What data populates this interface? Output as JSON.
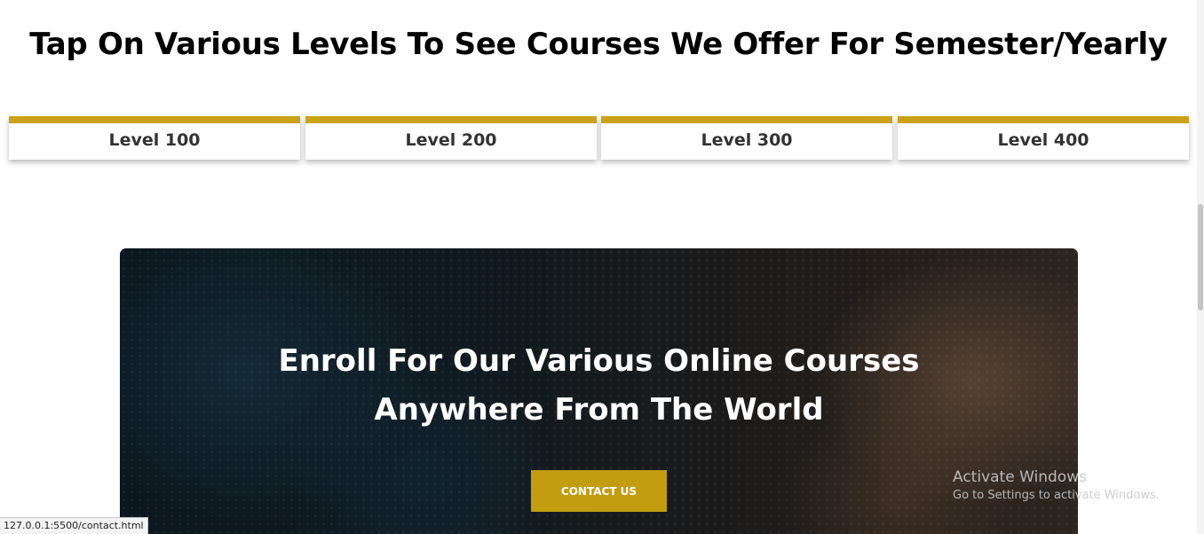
{
  "section": {
    "heading": "Tap On Various Levels To See Courses We Offer For Semester/Yearly",
    "levels": [
      {
        "label": "Level 100"
      },
      {
        "label": "Level 200"
      },
      {
        "label": "Level 300"
      },
      {
        "label": "Level 400"
      }
    ],
    "accent_color": "#c9a21a"
  },
  "banner": {
    "title_line1": "Enroll For Our Various Online Courses",
    "title_line2": "Anywhere From The World",
    "cta_label": "CONTACT US",
    "cta_color": "#c29d10"
  },
  "os_watermark": {
    "title": "Activate Windows",
    "subtitle": "Go to Settings to activate Windows."
  },
  "browser": {
    "status_url": "127.0.0.1:5500/contact.html"
  }
}
